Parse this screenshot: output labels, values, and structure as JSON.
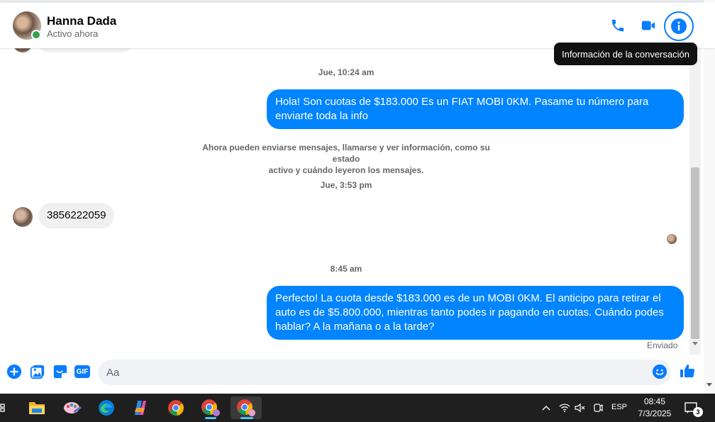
{
  "header": {
    "contact_name": "Hanna Dada",
    "status": "Activo ahora",
    "tooltip": "Información de la conversación"
  },
  "messages": {
    "ts1": "Jue, 10:24 am",
    "out1": "Hola! Son cuotas de $183.000 Es un FIAT MOBI 0KM. Pasame tu número para enviarte toda la info",
    "system_line1": "Ahora pueden enviarse mensajes, llamarse y ver información, como su estado",
    "system_line2": "activo y cuándo leyeron los mensajes.",
    "ts2": "Jue, 3:53 pm",
    "in1": "3856222059",
    "ts3": "8:45 am",
    "out2": "Perfecto! La cuota desde $183.000 es de un MOBI 0KM. El anticipo para retirar el auto es de $5.800.000, mientras tanto podes ir pagando en cuotas. Cuándo podes hablar? A la mañana o a la tarde?",
    "sent_status": "Enviado"
  },
  "composer": {
    "placeholder": "Aa",
    "gif_label": "GIF"
  },
  "taskbar": {
    "language": "ESP",
    "time": "08:45",
    "date": "7/3/2025",
    "notification_count": "3"
  },
  "colors": {
    "accent": "#0084ff",
    "incoming_bubble": "#f0f0f0",
    "online": "#31a24c",
    "taskbar": "#1f1f1f"
  },
  "icons": [
    "phone-icon",
    "video-icon",
    "info-icon",
    "plus-icon",
    "image-icon",
    "sticker-icon",
    "gif-icon",
    "emoji-icon",
    "like-icon"
  ]
}
